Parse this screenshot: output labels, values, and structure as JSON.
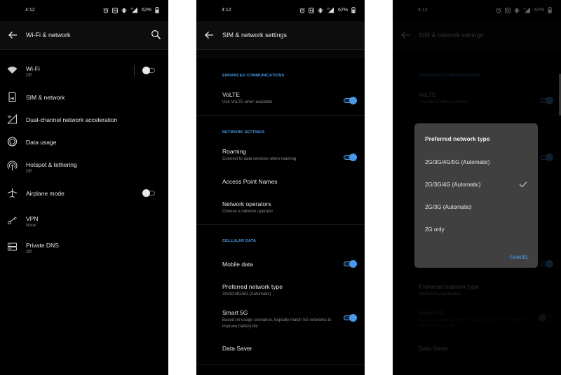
{
  "status_bar": {
    "time": "4:12",
    "battery_percent": "62%",
    "icons": [
      "alarm-icon",
      "nfc-icon",
      "vibrate-icon",
      "signal-icon",
      "battery-icon"
    ]
  },
  "colors": {
    "accent": "#4a9ae8",
    "background": "#000000",
    "dialog_bg": "#404040",
    "subtitle": "#8a8a8a"
  },
  "wifi_network_screen": {
    "title": "Wi-Fi & network",
    "items": [
      {
        "icon": "wifi-icon",
        "title": "Wi-Fi",
        "subtitle": "Off",
        "toggle": "off"
      },
      {
        "icon": "sim-card-icon",
        "title": "SIM & network"
      },
      {
        "icon": "dual-channel-icon",
        "title": "Dual-channel network acceleration"
      },
      {
        "icon": "data-usage-icon",
        "title": "Data usage"
      },
      {
        "icon": "hotspot-icon",
        "title": "Hotspot & tethering",
        "subtitle": "Off"
      },
      {
        "icon": "airplane-icon",
        "title": "Airplane mode",
        "toggle": "off"
      },
      {
        "icon": "vpn-key-icon",
        "title": "VPN",
        "subtitle": "None"
      },
      {
        "icon": "private-dns-icon",
        "title": "Private DNS",
        "subtitle": "Off"
      }
    ]
  },
  "sim_network_screen": {
    "title": "SIM & network settings",
    "sections": {
      "enhanced": "ENHANCED COMMUNICATIONS",
      "network": "NETWORK SETTINGS",
      "cellular": "CELLULAR DATA"
    },
    "items": {
      "volte": {
        "title": "VoLTE",
        "subtitle": "Use VoLTE when available",
        "toggle": "on"
      },
      "roaming": {
        "title": "Roaming",
        "subtitle": "Connect to data services when roaming",
        "toggle": "on"
      },
      "apn": {
        "title": "Access Point Names"
      },
      "operators": {
        "title": "Network operators",
        "subtitle": "Choose a network operator"
      },
      "mobile_data": {
        "title": "Mobile data",
        "toggle": "on"
      },
      "preferred": {
        "title": "Preferred network type",
        "subtitle": "2G/3G/4G/5G (Automatic)"
      },
      "smart5g": {
        "title": "Smart 5G",
        "subtitle": "Based on usage scenarios, logically match 5G networks to improve battery life",
        "toggle": "on"
      },
      "data_saver": {
        "title": "Data Saver"
      }
    }
  },
  "dialog_screen": {
    "title": "SIM & network settings",
    "preferred_subtitle": "2G/3G/4G (Automatic)",
    "smart5g_toggle": "off",
    "dialog": {
      "title": "Preferred network type",
      "options": [
        {
          "label": "2G/3G/4G/5G (Automatic)",
          "selected": false
        },
        {
          "label": "2G/3G/4G (Automatic)",
          "selected": true
        },
        {
          "label": "2G/3G (Automatic)",
          "selected": false
        },
        {
          "label": "2G only",
          "selected": false
        }
      ],
      "cancel_label": "CANCEL"
    }
  }
}
